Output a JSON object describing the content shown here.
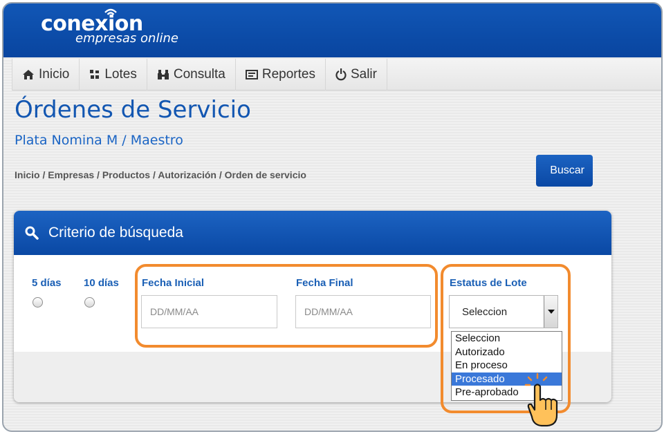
{
  "brand": {
    "name": "conexion",
    "tagline": "empresas online"
  },
  "nav": [
    {
      "label": "Inicio",
      "icon": "home-icon"
    },
    {
      "label": "Lotes",
      "icon": "lotes-icon"
    },
    {
      "label": "Consulta",
      "icon": "binoculars-icon"
    },
    {
      "label": "Reportes",
      "icon": "report-icon"
    },
    {
      "label": "Salir",
      "icon": "power-icon"
    }
  ],
  "page": {
    "title": "Órdenes de Servicio",
    "subtitle": "Plata Nomina M / Maestro",
    "breadcrumb": "Inicio / Empresas / Productos / Autorización / Orden de servicio"
  },
  "search": {
    "title": "Criterio de búsqueda",
    "range_5": "5 días",
    "range_10": "10 días",
    "fecha_inicial_label": "Fecha Inicial",
    "fecha_inicial_placeholder": "DD/MM/AA",
    "fecha_final_label": "Fecha Final",
    "fecha_final_placeholder": "DD/MM/AA",
    "estatus_label": "Estatus de Lote",
    "estatus_value": "Seleccion",
    "estatus_options": [
      "Seleccion",
      "Autorizado",
      "En proceso",
      "Procesado",
      "Pre-aprobado"
    ],
    "estatus_highlighted": "Procesado",
    "button": "Buscar"
  },
  "colors": {
    "brand_blue": "#0b4aa6",
    "link_blue": "#1a5fb5",
    "highlight_orange": "#f28b2e",
    "option_selected": "#3a78d9"
  }
}
